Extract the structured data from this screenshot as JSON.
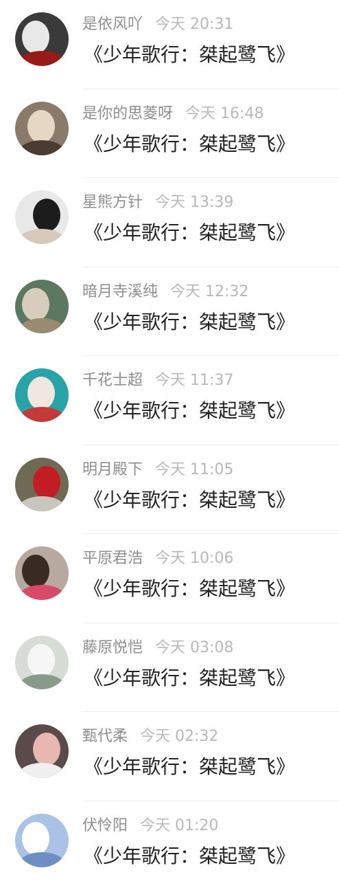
{
  "comments": [
    {
      "name": "是依风吖",
      "time": "今天 20:31",
      "text": "《少年歌行：桀起鹭飞》",
      "avatar": {
        "bg": "#3a3a3a",
        "fg": "#e8e8e8",
        "accent": "#9a1a1a"
      }
    },
    {
      "name": "是你的思菱呀",
      "time": "今天 16:48",
      "text": "《少年歌行：桀起鹭飞》",
      "avatar": {
        "bg": "#8a7a6a",
        "fg": "#e6d6c4",
        "accent": "#4a3c30"
      }
    },
    {
      "name": "星熊方针",
      "time": "今天 13:39",
      "text": "《少年歌行：桀起鹭飞》",
      "avatar": {
        "bg": "#e8e8e8",
        "fg": "#1c1c1c",
        "accent": "#d8c8bc"
      }
    },
    {
      "name": "暗月寺溪纯",
      "time": "今天 12:32",
      "text": "《少年歌行：桀起鹭飞》",
      "avatar": {
        "bg": "#5c7860",
        "fg": "#d8cdbd",
        "accent": "#9a8a72"
      }
    },
    {
      "name": "千花士超",
      "time": "今天 11:37",
      "text": "《少年歌行：桀起鹭飞》",
      "avatar": {
        "bg": "#2aa3a8",
        "fg": "#f2e6e0",
        "accent": "#c23a3a"
      }
    },
    {
      "name": "明月殿下",
      "time": "今天 11:05",
      "text": "《少年歌行：桀起鹭飞》",
      "avatar": {
        "bg": "#6e6a54",
        "fg": "#c41c24",
        "accent": "#c9c6bd"
      }
    },
    {
      "name": "平原君浩",
      "time": "今天 10:06",
      "text": "《少年歌行：桀起鹭飞》",
      "avatar": {
        "bg": "#b7a8a0",
        "fg": "#3a2a24",
        "accent": "#d94a6a"
      }
    },
    {
      "name": "藤原悦恺",
      "time": "今天 03:08",
      "text": "《少年歌行：桀起鹭飞》",
      "avatar": {
        "bg": "#d8dcd6",
        "fg": "#f6f6f6",
        "accent": "#8a9a8a"
      }
    },
    {
      "name": "甄代柔",
      "time": "今天 02:32",
      "text": "《少年歌行：桀起鹭飞》",
      "avatar": {
        "bg": "#5a4a4a",
        "fg": "#e8b8b0",
        "accent": "#f0f0f0"
      }
    },
    {
      "name": "伏怜阳",
      "time": "今天 01:20",
      "text": "《少年歌行：桀起鹭飞》",
      "avatar": {
        "bg": "#a9c2e6",
        "fg": "#ffffff",
        "accent": "#6d8fc4"
      }
    }
  ]
}
